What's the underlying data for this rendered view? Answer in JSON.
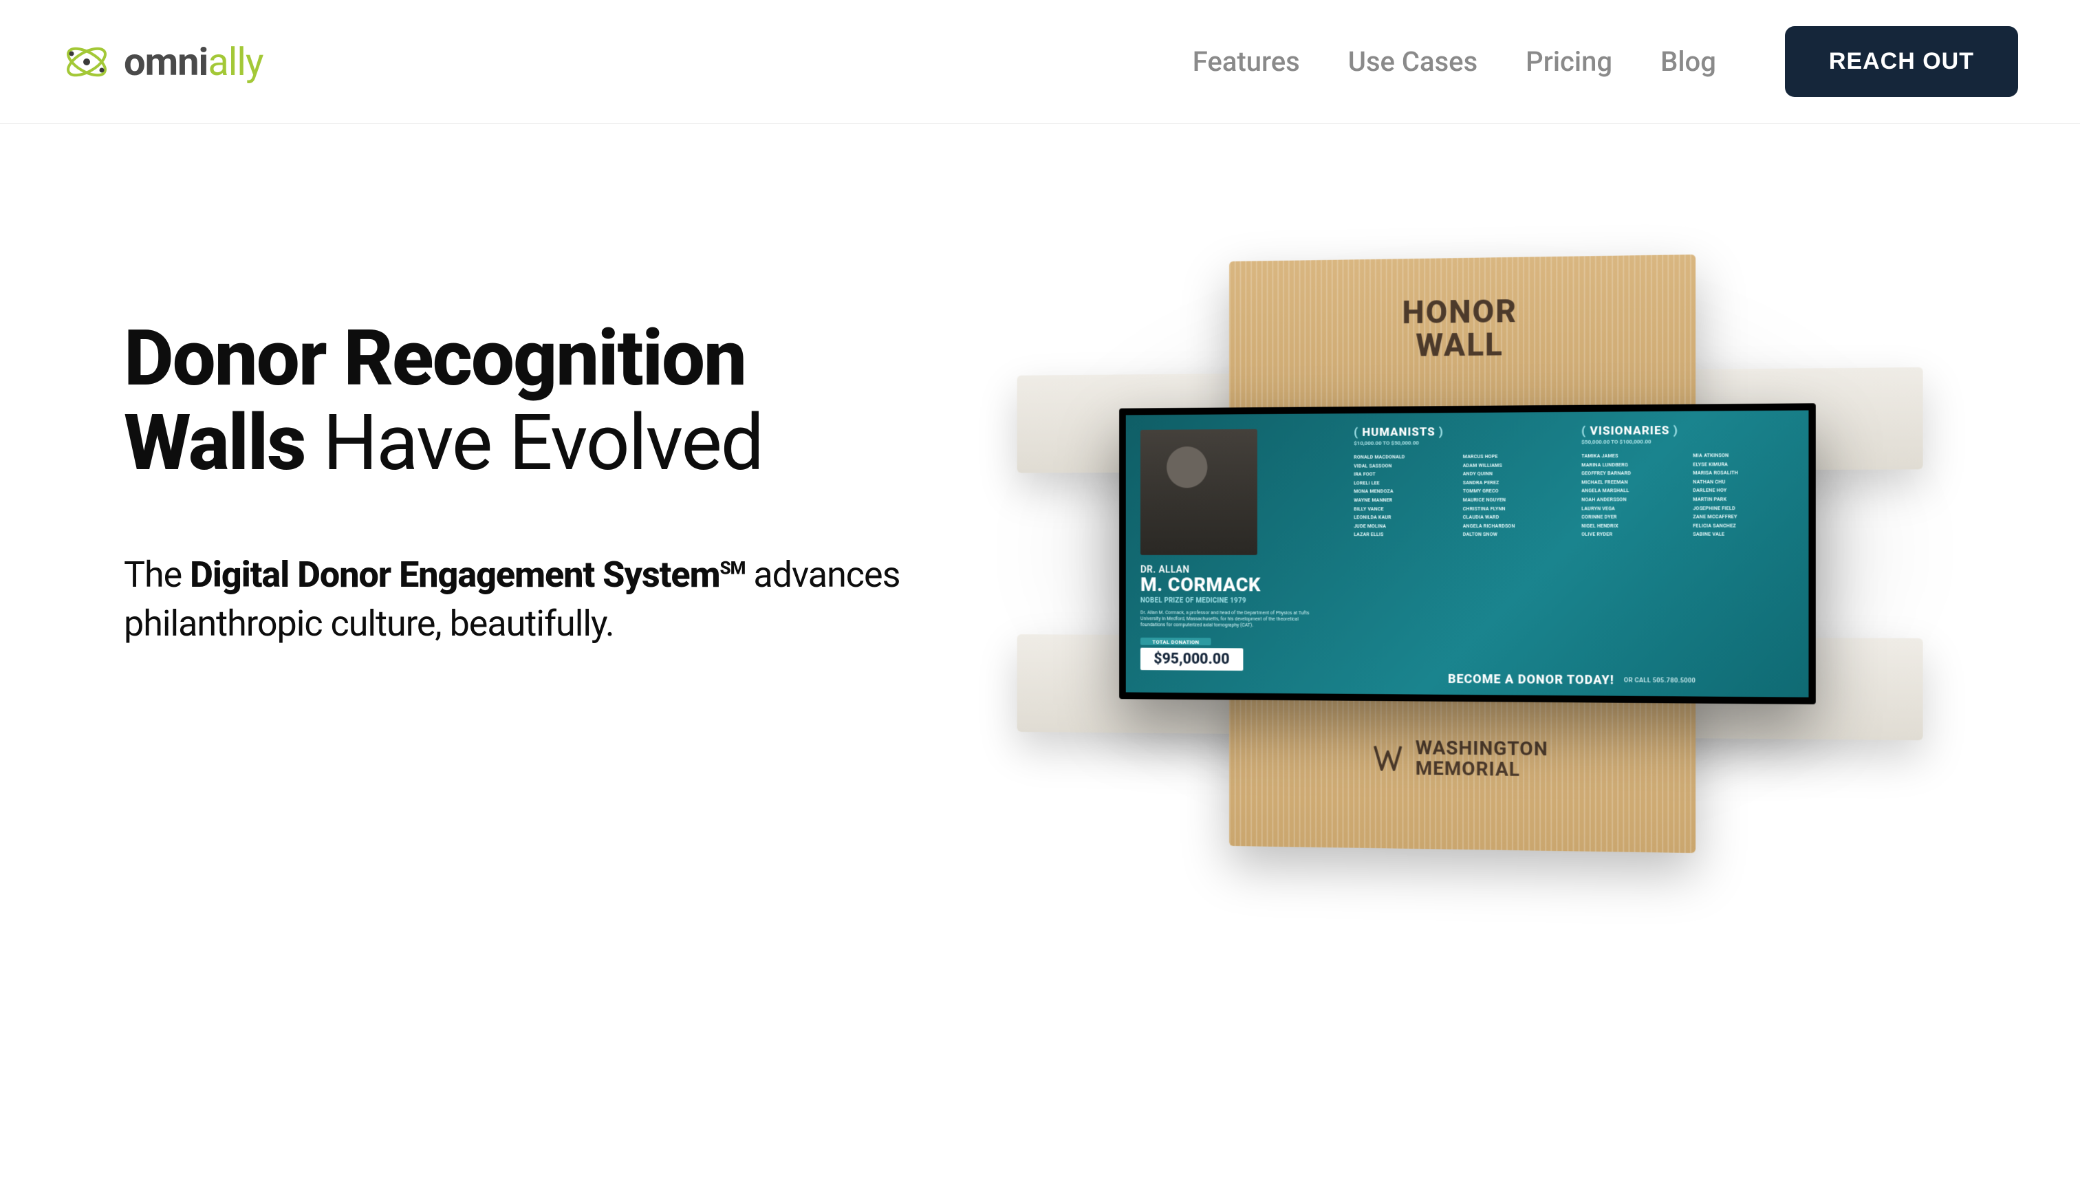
{
  "brand": {
    "name_bold": "omni",
    "name_light": "ally"
  },
  "nav": {
    "features": "Features",
    "use_cases": "Use Cases",
    "pricing": "Pricing",
    "blog": "Blog",
    "cta": "REACH OUT"
  },
  "colors": {
    "brand_green": "#a3c837",
    "cta_bg": "#15263a",
    "screen_bg": "#1a848e"
  },
  "hero": {
    "title_bold": "Donor Recognition Walls",
    "title_light": " Have Evolved",
    "sub_pre": "The ",
    "sub_bold": "Digital Donor Engagement System",
    "sub_sup": "SM",
    "sub_post": " advances philanthropic culture, beautifully."
  },
  "wall": {
    "top_label_line1": "HONOR",
    "top_label_line2": "WALL",
    "bottom_label_line1": "WASHINGTON",
    "bottom_label_line2": "MEMORIAL"
  },
  "screen": {
    "donor_prefix": "DR. ALLAN",
    "donor_name": "M. CORMACK",
    "donor_subtitle": "NOBEL PRIZE OF MEDICINE 1979",
    "donor_bio": "Dr. Allan M. Cormack, a professor and head of the Department of Physics at Tufts University in Medford, Massachusetts, for his development of the theoretical foundations for computerized axial tomography (CAT).",
    "total_label": "TOTAL DONATION",
    "total_amount": "$95,000.00",
    "cat1_title": "HUMANISTS",
    "cat1_range": "$10,000.00 TO $50,000.00",
    "cat2_title": "VISIONARIES",
    "cat2_range": "$50,000.00 TO $100,000.00",
    "become": "BECOME A DONOR TODAY!",
    "call": "OR CALL 505.780.5000",
    "names1": [
      "Ronald MacDonald",
      "Vidal Sassoon",
      "Ira Foot",
      "Loreli Lee",
      "Mona Mendoza",
      "Wayne Manner",
      "Billy Vance",
      "Leonilda Kaur",
      "Jude Molina",
      "Lazar Ellis",
      "Marcus Hope",
      "Adam Williams",
      "Andy Quinn",
      "Sandra Perez",
      "Tommy Greco",
      "Maurice Nguyen",
      "Christina Flynn",
      "Claudia Ward",
      "Angela Richardson",
      "Dalton Snow"
    ],
    "names2": [
      "Tamika James",
      "Marina Lundberg",
      "Geoffrey Barnard",
      "Michael Freeman",
      "Angela Marshall",
      "Noah Andersson",
      "Lauryn Vega",
      "Corinne Dyer",
      "Nigel Hendrix",
      "Olive Ryder",
      "Mia Atkinson",
      "Elyse Kimura",
      "Marisa Rosalith",
      "Nathan Chu",
      "Darlene Hoy",
      "Martin Park",
      "Josephine Field",
      "Zane McCaffrey",
      "Felicia Sanchez",
      "Sabine Vale"
    ]
  }
}
